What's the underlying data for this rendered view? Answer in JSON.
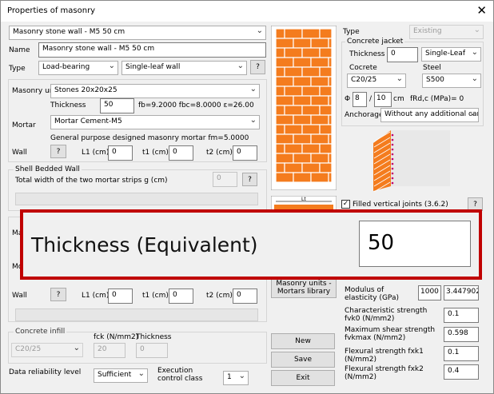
{
  "window": {
    "title": "Properties of masonry",
    "close_glyph": "✕"
  },
  "header": {
    "masonry_select": "Masonry stone wall - M5 50 cm",
    "name_label": "Name",
    "name_value": "Masonry stone wall - M5 50 cm",
    "type_label": "Type",
    "type_value": "Load-bearing",
    "leaf_value": "Single-leaf wall",
    "help": "?"
  },
  "masonry": {
    "unit_label": "Masonry uni",
    "unit_value": "Stones 20x20x25",
    "thickness_label": "Thickness",
    "thickness_value": "50",
    "strengths": "fb=9.2000 fbc=8.0000 ε=26.00",
    "mortar_label": "Mortar",
    "mortar_value": "Mortar Cement-M5",
    "mortar_desc": "General purpose designed masonry mortar fm=5.0000",
    "wall_label": "Wall",
    "l1_label": "L1 (cm)",
    "l1_value": "0",
    "t1_label": "t1 (cm)",
    "t1_value": "0",
    "t2_label": "t2 (cm)",
    "t2_value": "0"
  },
  "shell": {
    "title": "Shell Bedded Wall",
    "desc": "Total width of the two mortar strips g (cm)",
    "value": "0"
  },
  "lower": {
    "partial_ma": "Ma",
    "partial_mo": "Mo",
    "wall_label": "Wall",
    "l1_label": "L1 (cm)",
    "l1_value": "0",
    "t1_label": "t1 (cm)",
    "t1_value": "0",
    "t2_label": "t2 (cm)",
    "t2_value": "0"
  },
  "infill": {
    "title": "Concrete infill",
    "fck_label": "fck (N/mm2)",
    "thickness_label": "Thickness",
    "concrete_value": "C20/25",
    "fck_value": "20",
    "thickness_value": "0"
  },
  "reliability": {
    "label": "Data reliability level",
    "value": "Sufficient",
    "exec_label": "Execution control class",
    "exec_value": "1"
  },
  "right": {
    "type_label": "Type",
    "type_value": "Existing",
    "jacket_title": "Concrete jacket",
    "thickness_label": "Thickness",
    "thickness_value": "0",
    "leaf_value": "Single-Leaf",
    "concrete_label": "Cocrete",
    "concrete_value": "C20/25",
    "steel_label": "Steel",
    "steel_value": "S500",
    "phi_label": "Φ",
    "phi_value": "8",
    "slash": "/",
    "spacing_value": "10",
    "cm_label": "cm",
    "frd_label": "fRd,c (MPa)= 0",
    "anchorage_label": "Anchorage",
    "anchorage_value": "Without any additional care",
    "filled_joints_label": "Filled vertical joints (3.6.2)",
    "filled_joints_checked": "✓"
  },
  "mech": {
    "modulus_label": "Modulus of elasticity (GPa)",
    "modulus_value": "1000",
    "modulus_calc": "3.447902",
    "fvk0_label": "Characteristic strength fvk0 (N/mm2)",
    "fvk0_value": "0.1",
    "fvkmax_label": "Maximum shear strength fvkmax (N/mm2)",
    "fvkmax_value": "0.598",
    "fxk1_label": "Flexural strength fxk1 (N/mm2)",
    "fxk1_value": "0.1",
    "fxk2_label": "Flexural strength fxk2 (N/mm2)",
    "fxk2_value": "0.4"
  },
  "buttons": {
    "library": "Masonry units - Mortars library",
    "new": "New",
    "save": "Save",
    "exit": "Exit"
  },
  "diagram": {
    "dim_label": "Lt"
  },
  "zoom": {
    "label": "Thickness (Equivalent)",
    "value": "50",
    "highlight_color": "#c00000"
  },
  "colors": {
    "brick": "#f47c1e",
    "jacket_pins": "#c0006a"
  }
}
